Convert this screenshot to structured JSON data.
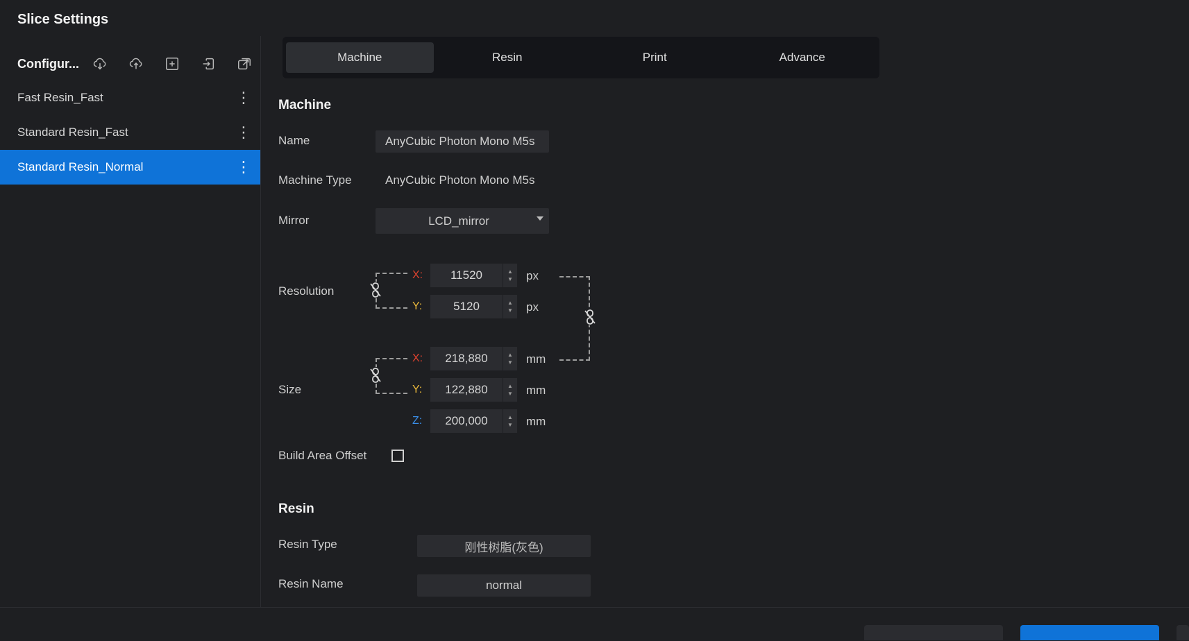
{
  "window": {
    "title": "Slice Settings"
  },
  "sidebar": {
    "config_label": "Configur...",
    "icons": [
      "cloud-download-icon",
      "cloud-upload-icon",
      "add-box-icon",
      "import-icon",
      "export-icon"
    ],
    "items": [
      {
        "label": "Fast Resin_Fast",
        "active": false
      },
      {
        "label": "Standard Resin_Fast",
        "active": false
      },
      {
        "label": "Standard Resin_Normal",
        "active": true
      }
    ]
  },
  "tabs": [
    {
      "label": "Machine",
      "active": true
    },
    {
      "label": "Resin",
      "active": false
    },
    {
      "label": "Print",
      "active": false
    },
    {
      "label": "Advance",
      "active": false
    }
  ],
  "machine": {
    "section_title": "Machine",
    "name_label": "Name",
    "name_value": "AnyCubic Photon Mono M5s",
    "type_label": "Machine Type",
    "type_value": "AnyCubic Photon Mono M5s",
    "mirror_label": "Mirror",
    "mirror_value": "LCD_mirror",
    "resolution_label": "Resolution",
    "res_x_axis": "X:",
    "res_x": "11520",
    "res_y_axis": "Y:",
    "res_y": "5120",
    "res_unit": "px",
    "size_label": "Size",
    "size_x_axis": "X:",
    "size_x": "218,880",
    "size_y_axis": "Y:",
    "size_y": "122,880",
    "size_z_axis": "Z:",
    "size_z": "200,000",
    "size_unit": "mm",
    "offset_label": "Build Area Offset",
    "offset_checked": false
  },
  "resin": {
    "section_title": "Resin",
    "type_label": "Resin Type",
    "type_value": "刚性树脂(灰色)",
    "name_label": "Resin Name",
    "name_value": "normal"
  },
  "colors": {
    "accent": "#0f73d8",
    "x_axis": "#e0432f",
    "y_axis": "#e8b73a",
    "z_axis": "#3a8ee8"
  }
}
